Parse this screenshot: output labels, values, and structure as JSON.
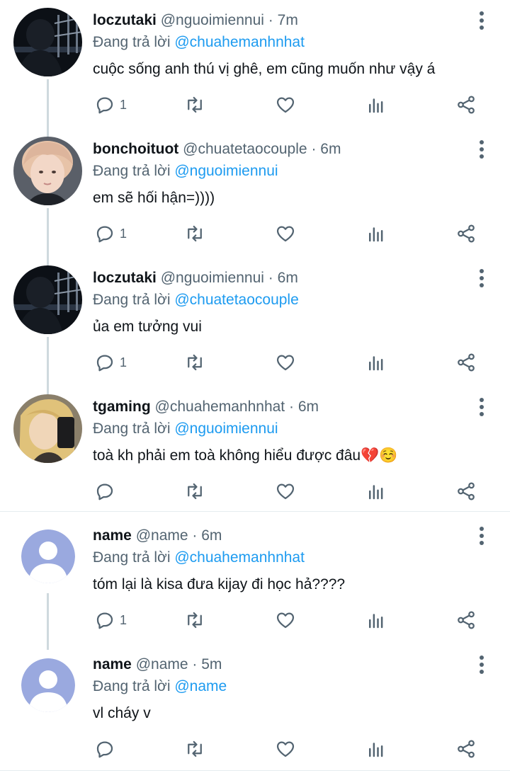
{
  "tweets": [
    {
      "name": "loczutaki",
      "handle": "@nguoimiennui",
      "dot": "·",
      "time": "7m",
      "reply_prefix": "Đang trả lời",
      "reply_to": "@chuahemanhnhat",
      "text": "cuộc sống anh thú vị ghê, em cũng muốn như vậy á",
      "reply_count": "1",
      "avatar": "dark-photo"
    },
    {
      "name": "bonchoituot",
      "handle": "@chuatetaocouple",
      "dot": "·",
      "time": "6m",
      "reply_prefix": "Đang trả lời",
      "reply_to": "@nguoimiennui",
      "text": "em sẽ hối hận=))))",
      "reply_count": "1",
      "avatar": "portrait-photo"
    },
    {
      "name": "loczutaki",
      "handle": "@nguoimiennui",
      "dot": "·",
      "time": "6m",
      "reply_prefix": "Đang trả lời",
      "reply_to": "@chuatetaocouple",
      "text": "ủa em tưởng vui",
      "reply_count": "1",
      "avatar": "dark-photo"
    },
    {
      "name": "tgaming",
      "handle": "@chuahemanhnhat",
      "dot": "·",
      "time": "6m",
      "reply_prefix": "Đang trả lời",
      "reply_to": "@nguoimiennui",
      "text": "toà kh phải em toà không hiểu được đâu💔☺️",
      "reply_count": "",
      "avatar": "selfie-photo"
    },
    {
      "name": "name",
      "handle": "@name",
      "dot": "·",
      "time": "6m",
      "reply_prefix": "Đang trả lời",
      "reply_to": "@chuahemanhnhat",
      "text": "tóm lại là kisa đưa kijay đi học hả????",
      "reply_count": "1",
      "avatar": "default-avatar"
    },
    {
      "name": "name",
      "handle": "@name",
      "dot": "·",
      "time": "5m",
      "reply_prefix": "Đang trả lời",
      "reply_to": "@name",
      "text": "vl cháy v",
      "reply_count": "",
      "avatar": "default-avatar"
    }
  ],
  "colors": {
    "accent": "#1d9bf0",
    "secondary": "#536471",
    "avatar_default": "#9aa9df"
  }
}
